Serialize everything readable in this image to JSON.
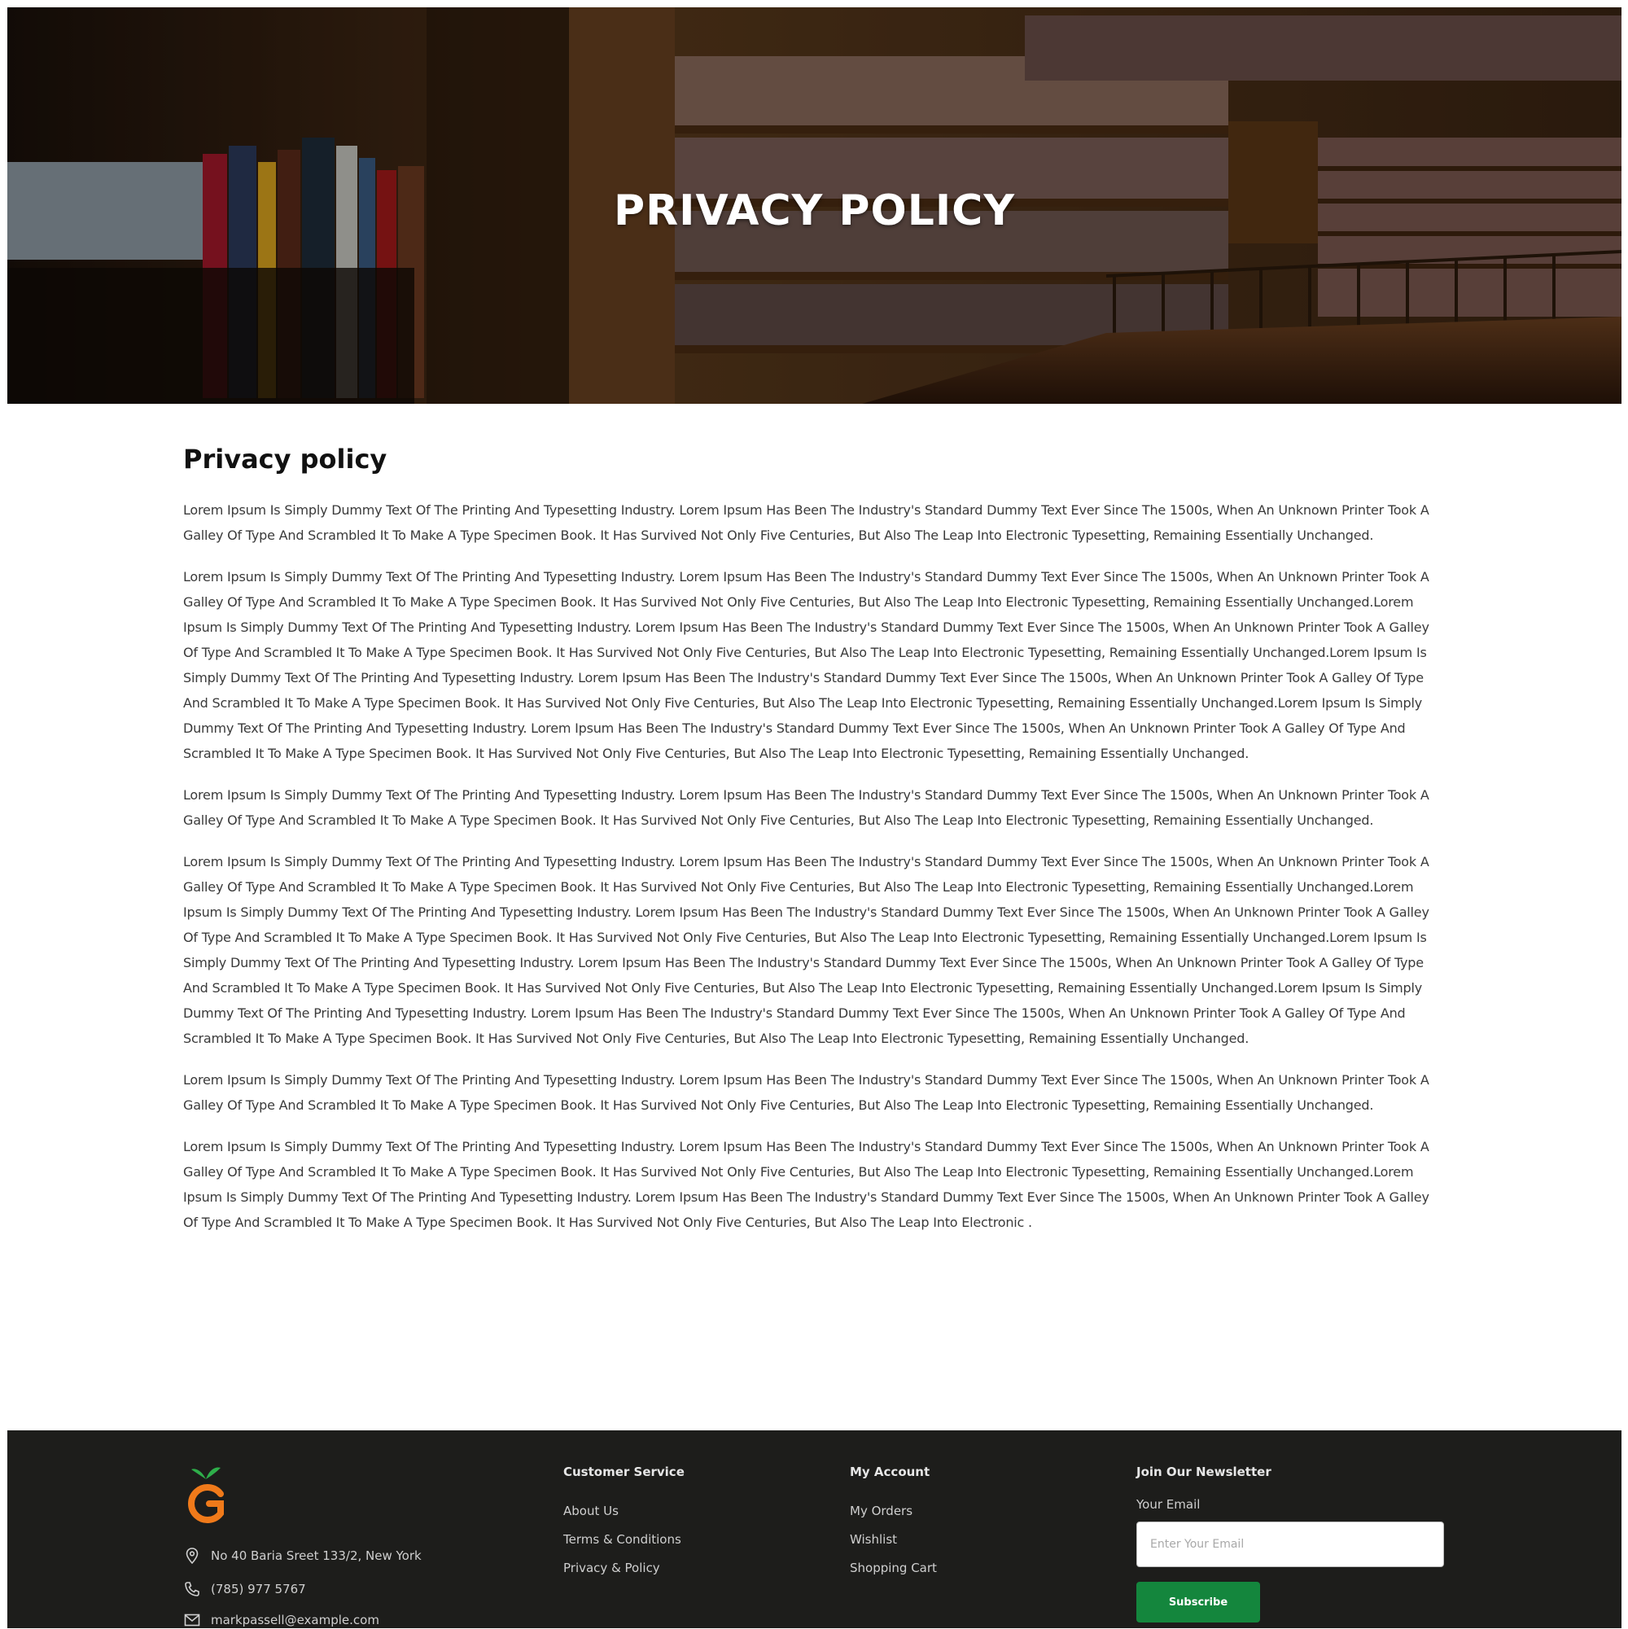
{
  "hero": {
    "title": "PRIVACY POLICY"
  },
  "content": {
    "heading": "Privacy policy",
    "paragraphs": [
      "Lorem Ipsum Is Simply Dummy Text Of The Printing And Typesetting Industry. Lorem Ipsum Has Been The Industry's Standard Dummy Text Ever Since The 1500s, When An Unknown Printer Took A Galley Of Type And Scrambled It To Make A Type Specimen Book. It Has Survived Not Only Five Centuries, But Also The Leap Into Electronic Typesetting, Remaining Essentially Unchanged.",
      "Lorem Ipsum Is Simply Dummy Text Of The Printing And Typesetting Industry. Lorem Ipsum Has Been The Industry's Standard Dummy Text Ever Since The 1500s, When An Unknown Printer Took A Galley Of Type And Scrambled It To Make A Type Specimen Book. It Has Survived Not Only Five Centuries, But Also The Leap Into Electronic Typesetting, Remaining Essentially Unchanged.Lorem Ipsum Is Simply Dummy Text Of The Printing And Typesetting Industry. Lorem Ipsum Has Been The Industry's Standard Dummy Text Ever Since The 1500s, When An Unknown Printer Took A Galley Of Type And Scrambled It To Make A Type Specimen Book. It Has Survived Not Only Five Centuries, But Also The Leap Into Electronic Typesetting, Remaining Essentially Unchanged.Lorem Ipsum Is Simply Dummy Text Of The Printing And Typesetting Industry. Lorem Ipsum Has Been The Industry's Standard Dummy Text Ever Since The 1500s, When An Unknown Printer Took A Galley Of Type And Scrambled It To Make A Type Specimen Book. It Has Survived Not Only Five Centuries, But Also The Leap Into Electronic Typesetting, Remaining Essentially Unchanged.Lorem Ipsum Is Simply Dummy Text Of The Printing And Typesetting Industry. Lorem Ipsum Has Been The Industry's Standard Dummy Text Ever Since The 1500s, When An Unknown Printer Took A Galley Of Type And Scrambled It To Make A Type Specimen Book. It Has Survived Not Only Five Centuries, But Also The Leap Into Electronic Typesetting, Remaining Essentially Unchanged.",
      "Lorem Ipsum Is Simply Dummy Text Of The Printing And Typesetting Industry. Lorem Ipsum Has Been The Industry's Standard Dummy Text Ever Since The 1500s, When An Unknown Printer Took A Galley Of Type And Scrambled It To Make A Type Specimen Book. It Has Survived Not Only Five Centuries, But Also The Leap Into Electronic Typesetting, Remaining Essentially Unchanged.",
      "Lorem Ipsum Is Simply Dummy Text Of The Printing And Typesetting Industry. Lorem Ipsum Has Been The Industry's Standard Dummy Text Ever Since The 1500s, When An Unknown Printer Took A Galley Of Type And Scrambled It To Make A Type Specimen Book. It Has Survived Not Only Five Centuries, But Also The Leap Into Electronic Typesetting, Remaining Essentially Unchanged.Lorem Ipsum Is Simply Dummy Text Of The Printing And Typesetting Industry. Lorem Ipsum Has Been The Industry's Standard Dummy Text Ever Since The 1500s, When An Unknown Printer Took A Galley Of Type And Scrambled It To Make A Type Specimen Book. It Has Survived Not Only Five Centuries, But Also The Leap Into Electronic Typesetting, Remaining Essentially Unchanged.Lorem Ipsum Is Simply Dummy Text Of The Printing And Typesetting Industry. Lorem Ipsum Has Been The Industry's Standard Dummy Text Ever Since The 1500s, When An Unknown Printer Took A Galley Of Type And Scrambled It To Make A Type Specimen Book. It Has Survived Not Only Five Centuries, But Also The Leap Into Electronic Typesetting, Remaining Essentially Unchanged.Lorem Ipsum Is Simply Dummy Text Of The Printing And Typesetting Industry. Lorem Ipsum Has Been The Industry's Standard Dummy Text Ever Since The 1500s, When An Unknown Printer Took A Galley Of Type And Scrambled It To Make A Type Specimen Book. It Has Survived Not Only Five Centuries, But Also The Leap Into Electronic Typesetting, Remaining Essentially Unchanged.",
      "Lorem Ipsum Is Simply Dummy Text Of The Printing And Typesetting Industry. Lorem Ipsum Has Been The Industry's Standard Dummy Text Ever Since The 1500s, When An Unknown Printer Took A Galley Of Type And Scrambled It To Make A Type Specimen Book. It Has Survived Not Only Five Centuries, But Also The Leap Into Electronic Typesetting, Remaining Essentially Unchanged.",
      "Lorem Ipsum Is Simply Dummy Text Of The Printing And Typesetting Industry. Lorem Ipsum Has Been The Industry's Standard Dummy Text Ever Since The 1500s, When An Unknown Printer Took A Galley Of Type And Scrambled It To Make A Type Specimen Book. It Has Survived Not Only Five Centuries, But Also The Leap Into Electronic Typesetting, Remaining Essentially Unchanged.Lorem Ipsum Is Simply Dummy Text Of The Printing And Typesetting Industry. Lorem Ipsum Has Been The Industry's Standard Dummy Text Ever Since The 1500s, When An Unknown Printer Took A Galley Of Type And Scrambled It To Make A Type Specimen Book. It Has Survived Not Only Five Centuries, But Also The Leap Into Electronic ."
    ]
  },
  "footer": {
    "address": "No 40 Baria Sreet 133/2, New York",
    "phone": "(785) 977 5767",
    "email": "markpassell@example.com",
    "customer_service": {
      "title": "Customer Service",
      "links": [
        "About Us",
        "Terms & Conditions",
        "Privacy & Policy"
      ]
    },
    "my_account": {
      "title": "My Account",
      "links": [
        "My Orders",
        "Wishlist",
        "Shopping Cart"
      ]
    },
    "newsletter": {
      "title": "Join Our Newsletter",
      "label": "Your Email",
      "placeholder": "Enter Your Email",
      "button": "Subscribe"
    },
    "colors": {
      "background": "#1d1d1b",
      "accent_green": "#14863d",
      "logo_orange": "#f07a1a",
      "logo_leaf": "#2eae4a"
    }
  }
}
